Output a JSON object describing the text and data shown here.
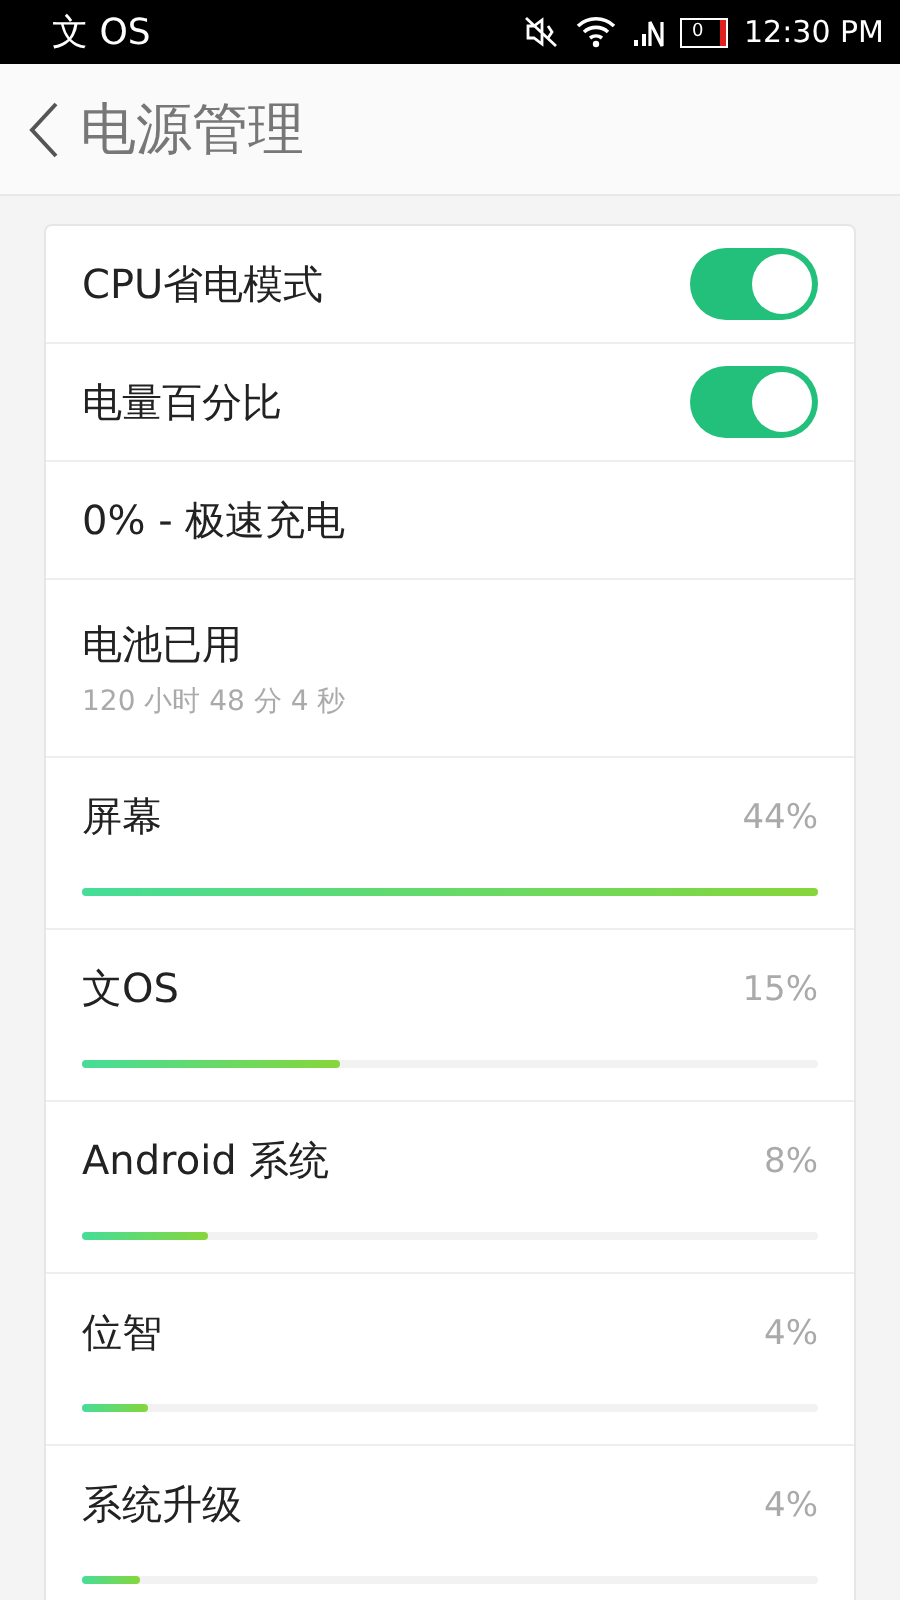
{
  "status_bar": {
    "carrier": "文 OS",
    "battery_text": "0",
    "time": "12:30 PM"
  },
  "header": {
    "title": "电源管理"
  },
  "settings": [
    {
      "kind": "toggle",
      "label": "CPU省电模式",
      "on": true
    },
    {
      "kind": "toggle",
      "label": "电量百分比",
      "on": true
    },
    {
      "kind": "text",
      "label": "0% - 极速充电"
    },
    {
      "kind": "info",
      "label": "电池已用",
      "detail": "120 小时 48 分 4 秒"
    }
  ],
  "usage": [
    {
      "name": "屏幕",
      "percent": "44%",
      "level": 1.0
    },
    {
      "name": "文OS",
      "percent": "15%",
      "level": 0.35
    },
    {
      "name": "Android 系统",
      "percent": "8%",
      "level": 0.17
    },
    {
      "name": "位智",
      "percent": "4%",
      "level": 0.09
    },
    {
      "name": "系统升级",
      "percent": "4%",
      "level": 0.08
    }
  ]
}
